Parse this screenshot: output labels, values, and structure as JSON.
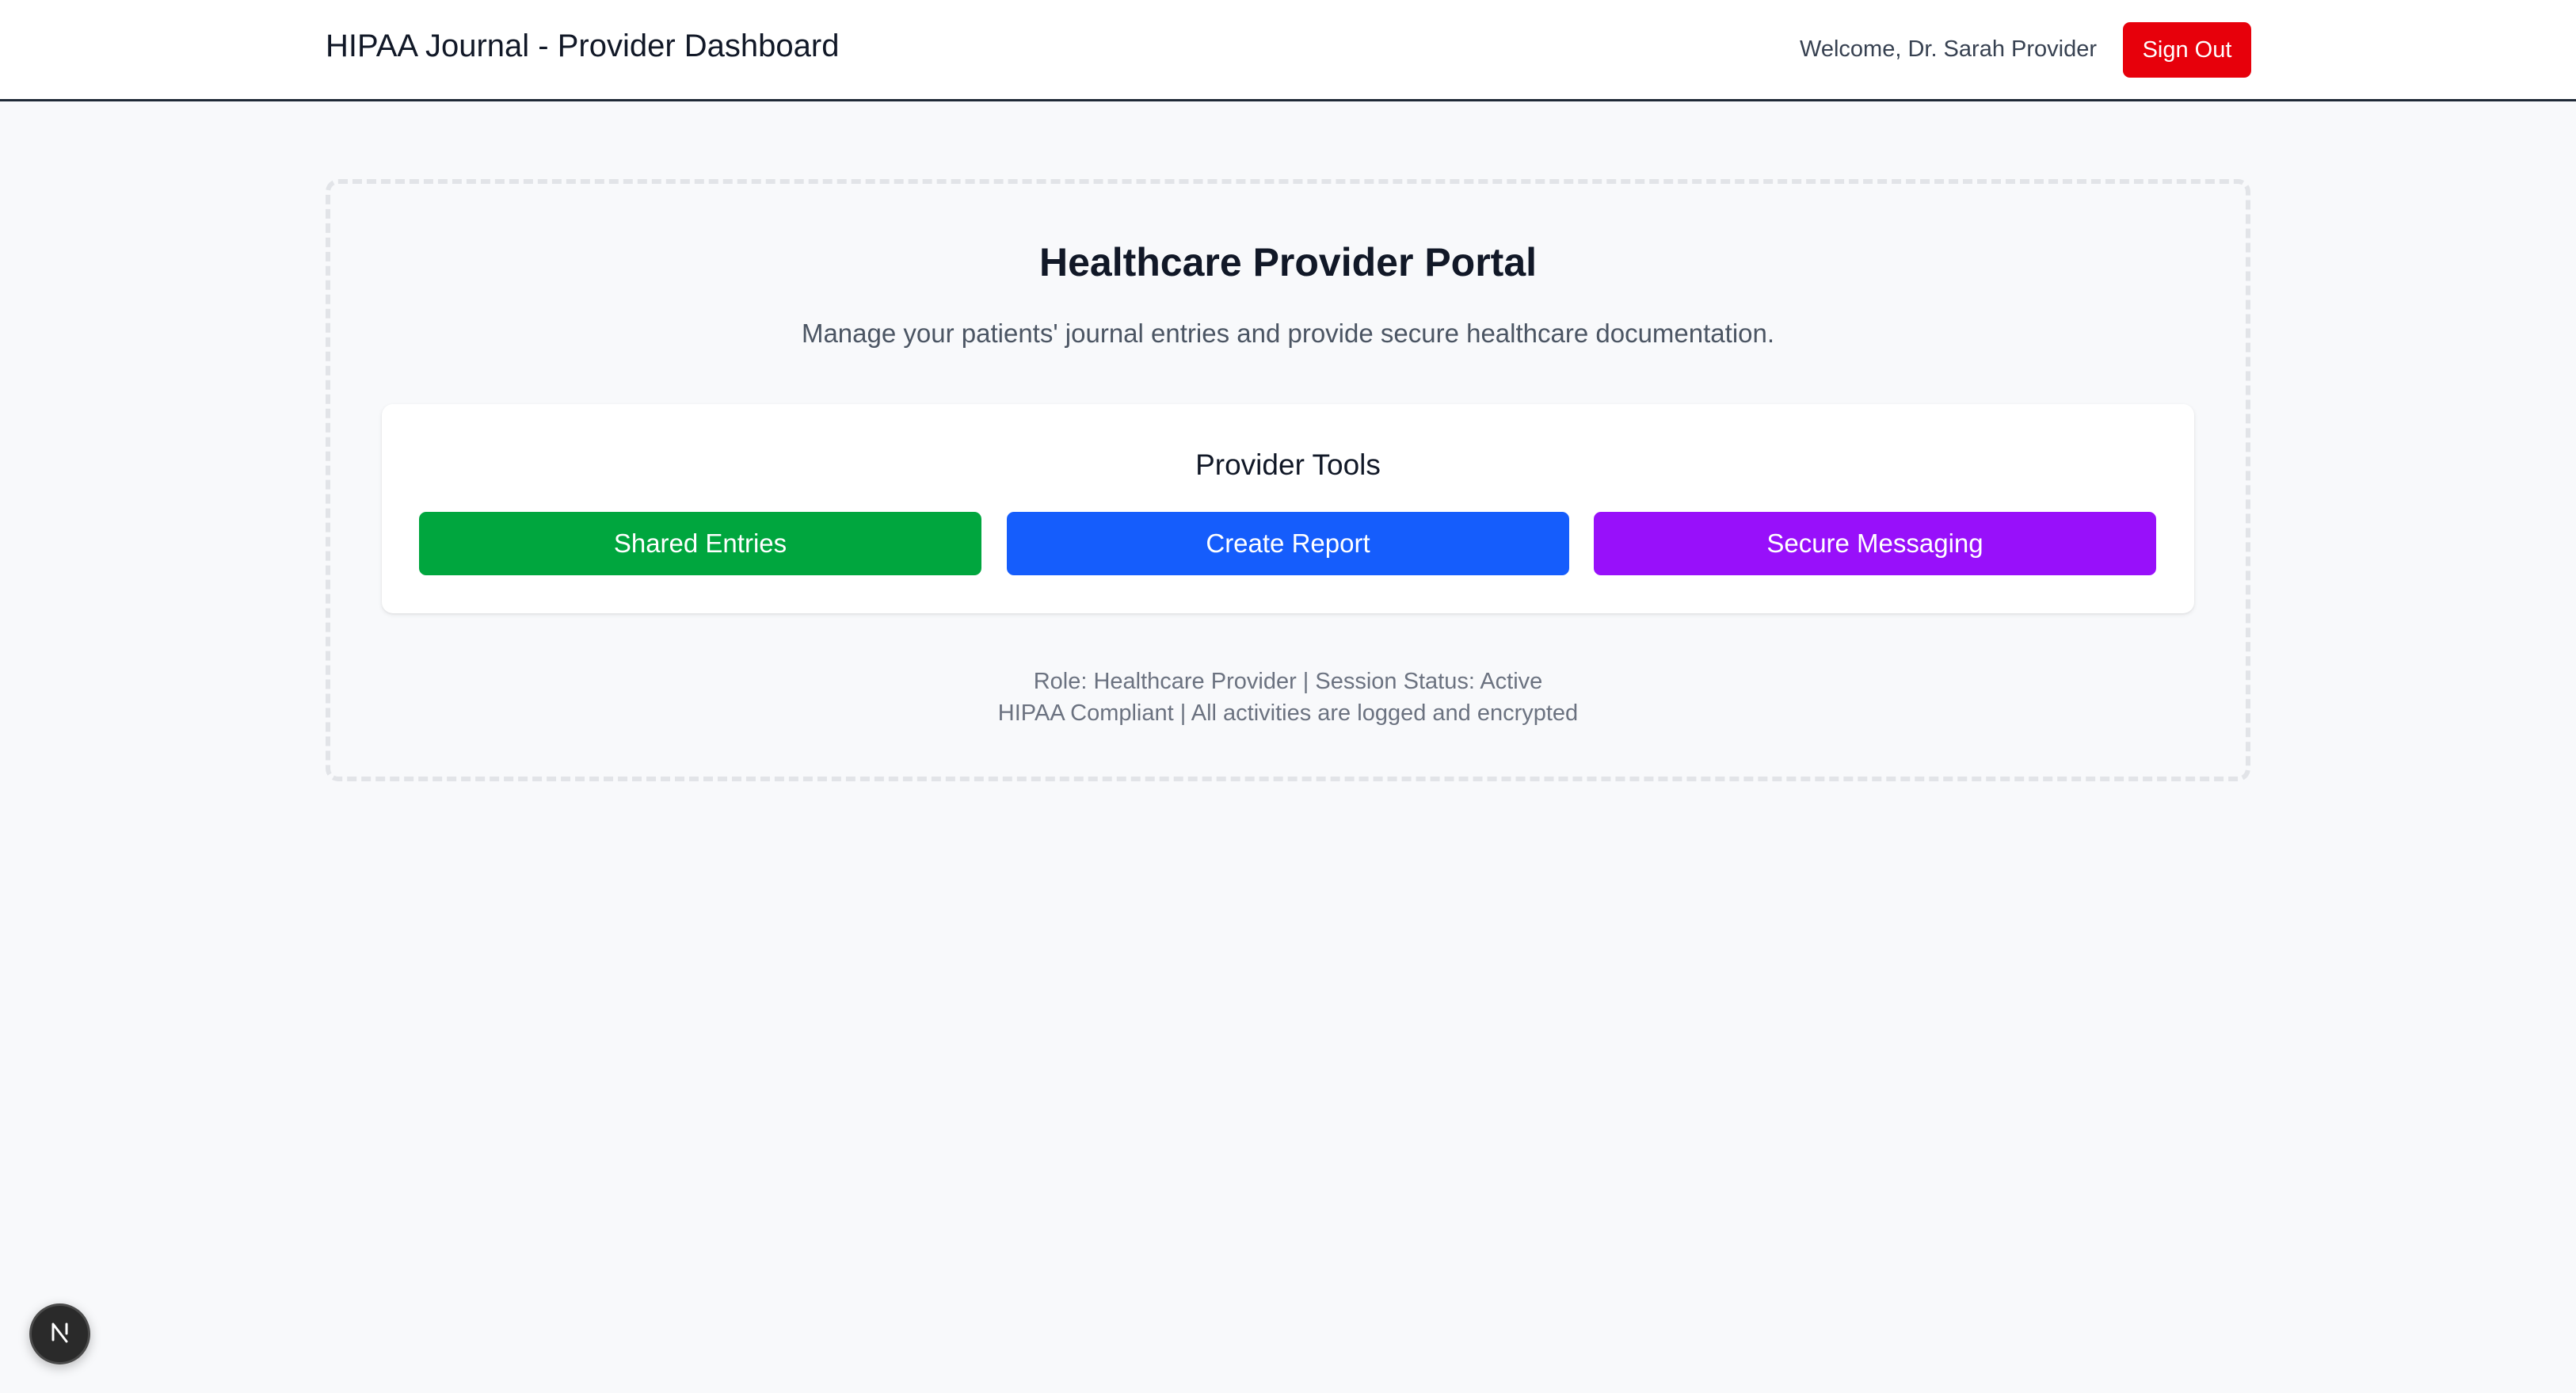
{
  "header": {
    "title": "HIPAA Journal - Provider Dashboard",
    "welcome": "Welcome, Dr. Sarah Provider",
    "signout_label": "Sign Out"
  },
  "portal": {
    "title": "Healthcare Provider Portal",
    "description": "Manage your patients' journal entries and provide secure healthcare documentation.",
    "tools": {
      "title": "Provider Tools",
      "buttons": [
        {
          "label": "Shared Entries",
          "color": "#00a63e"
        },
        {
          "label": "Create Report",
          "color": "#155dfc"
        },
        {
          "label": "Secure Messaging",
          "color": "#9810fa"
        }
      ]
    },
    "footer": {
      "line1": "Role: Healthcare Provider | Session Status: Active",
      "line2": "HIPAA Compliant | All activities are logged and encrypted"
    }
  },
  "colors": {
    "signout": "#e7000b",
    "background": "#f8f9fb"
  },
  "dev_badge": {
    "icon": "next-logo-icon"
  }
}
